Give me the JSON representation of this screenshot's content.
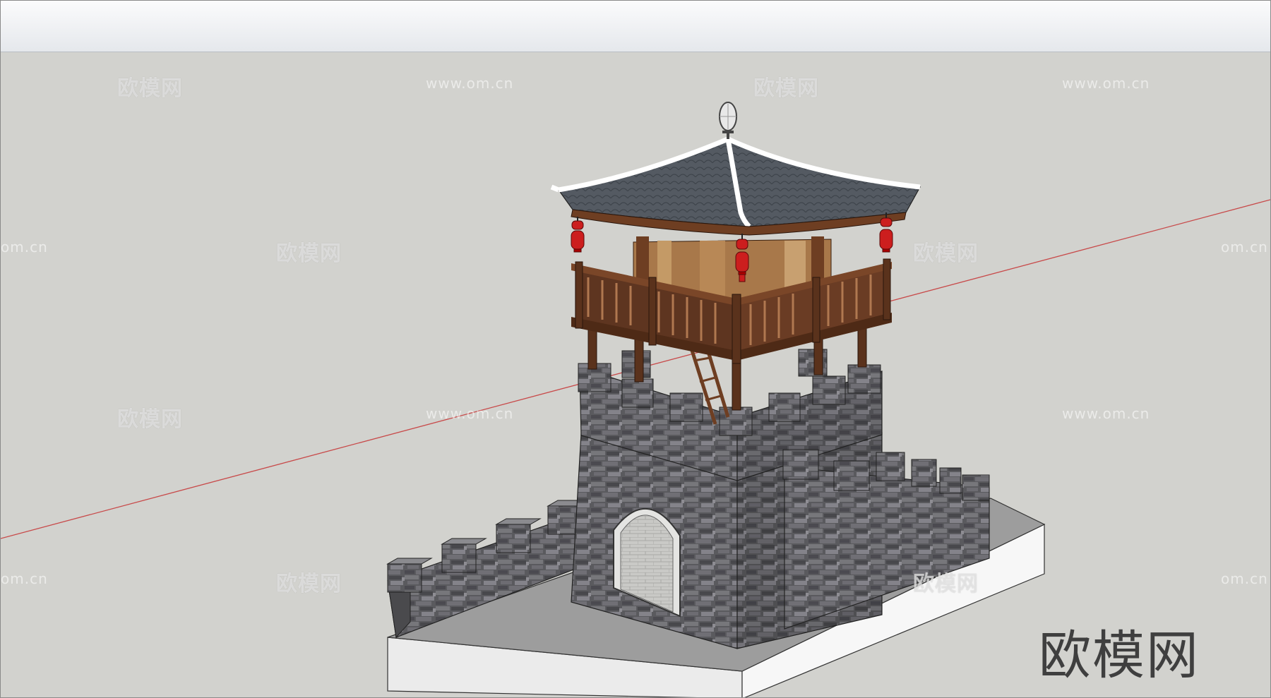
{
  "app": {
    "toolbar": {
      "label": ""
    }
  },
  "viewport": {
    "background": "#d2d2ce",
    "axis_color": "#c84a4a",
    "model": "watchtower-model"
  },
  "watermarks": {
    "brand_text": "欧模网",
    "url_text": "www.om.cn",
    "url_partial": "om.cn",
    "corner_logo_text": "欧模网"
  },
  "colors": {
    "stone": "#5b5b5e",
    "wood": "#6e3e22",
    "roof_tile": "#535960",
    "lantern": "#cc1e1e",
    "base": "#ffffff"
  }
}
